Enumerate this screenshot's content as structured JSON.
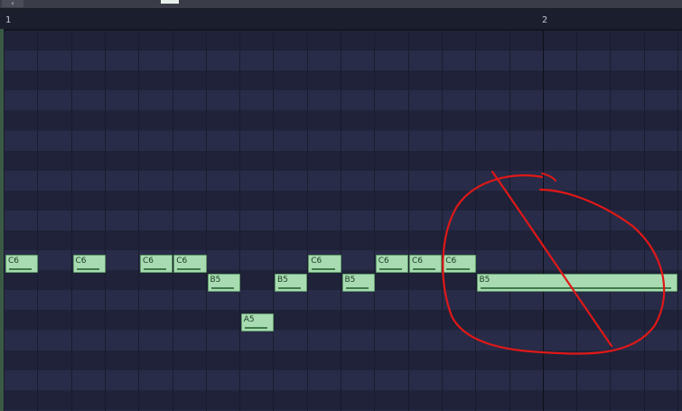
{
  "ruler": {
    "bars": [
      "1",
      "2"
    ]
  },
  "notes": [
    {
      "pitch": "C6",
      "start": 0,
      "length": 0.5
    },
    {
      "pitch": "C6",
      "start": 1,
      "length": 0.5
    },
    {
      "pitch": "C6",
      "start": 2,
      "length": 0.5
    },
    {
      "pitch": "C6",
      "start": 2.5,
      "length": 0.5
    },
    {
      "pitch": "B5",
      "start": 3,
      "length": 0.5
    },
    {
      "pitch": "A5",
      "start": 3.5,
      "length": 0.5
    },
    {
      "pitch": "B5",
      "start": 4,
      "length": 0.5
    },
    {
      "pitch": "C6",
      "start": 4.5,
      "length": 0.5
    },
    {
      "pitch": "B5",
      "start": 5,
      "length": 0.5
    },
    {
      "pitch": "C6",
      "start": 5.5,
      "length": 0.5
    },
    {
      "pitch": "C6",
      "start": 6,
      "length": 0.5
    },
    {
      "pitch": "C6",
      "start": 6.5,
      "length": 0.5
    },
    {
      "pitch": "B5",
      "start": 7,
      "length": 3
    }
  ],
  "colors": {
    "note_fill": "#a8dbb1",
    "annotation": "#e01818"
  }
}
